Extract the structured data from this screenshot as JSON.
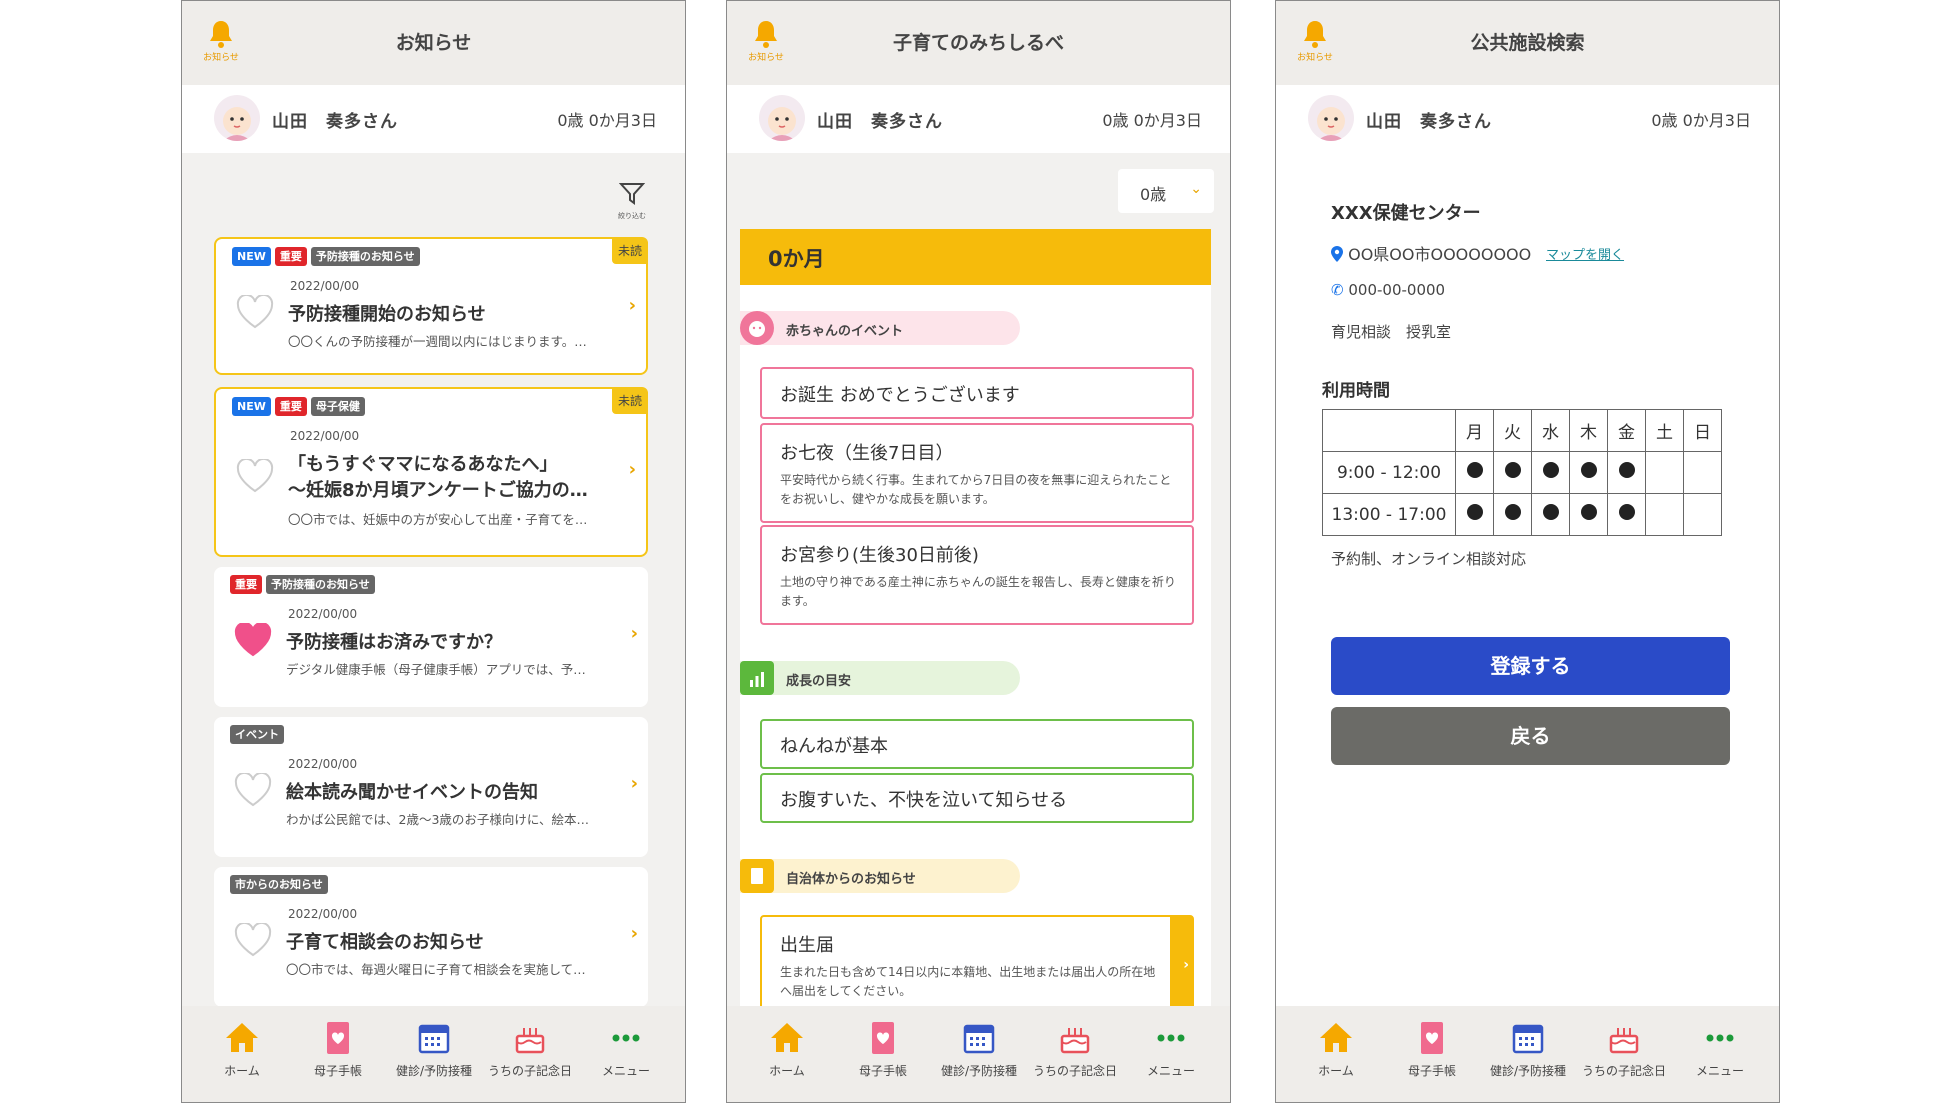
{
  "common": {
    "bell_label": "お知らせ",
    "user_name": "山田　奏多さん",
    "user_age": "0歳 0か月3日",
    "nav": [
      "ホーム",
      "母子手帳",
      "健診/予防接種",
      "うちの子記念日",
      "メニュー"
    ]
  },
  "notices": {
    "title": "お知らせ",
    "filter_label": "絞り込む",
    "unread_label": "未読",
    "items": [
      {
        "tags": [
          "NEW",
          "重要",
          "予防接種のお知らせ"
        ],
        "date": "2022/00/00",
        "title": "予防接種開始のお知らせ",
        "title2": "",
        "excerpt": "〇〇くんの予防接種が一週間以内にはじまります。…",
        "unread": true,
        "liked": false
      },
      {
        "tags": [
          "NEW",
          "重要",
          "母子保健"
        ],
        "date": "2022/00/00",
        "title": "「もうすぐママになるあなたへ」",
        "title2": "～妊娠8か月頃アンケートご協力の…",
        "excerpt": "〇〇市では、妊娠中の方が安心して出産・子育てを…",
        "unread": true,
        "liked": false
      },
      {
        "tags": [
          "重要",
          "予防接種のお知らせ"
        ],
        "date": "2022/00/00",
        "title": "予防接種はお済みですか？",
        "title2": "",
        "excerpt": "デジタル健康手帳（母子健康手帳）アプリでは、予…",
        "unread": false,
        "liked": true
      },
      {
        "tags": [
          "イベント"
        ],
        "date": "2022/00/00",
        "title": "絵本読み聞かせイベントの告知",
        "title2": "",
        "excerpt": "わかば公民館では、2歳～3歳のお子様向けに、絵本…",
        "unread": false,
        "liked": false
      },
      {
        "tags": [
          "市からのお知らせ"
        ],
        "date": "2022/00/00",
        "title": "子育て相談会のお知らせ",
        "title2": "",
        "excerpt": "〇〇市では、毎週火曜日に子育て相談会を実施して…",
        "unread": false,
        "liked": false
      }
    ]
  },
  "guide": {
    "title": "子育てのみちしるべ",
    "age_select": "0歳",
    "month": "0か月",
    "sec_baby": "赤ちゃんのイベント",
    "events": [
      {
        "title": "お誕生 おめでとうございます",
        "desc": ""
      },
      {
        "title": "お七夜（生後7日目）",
        "desc": "平安時代から続く行事。生まれてから7日目の夜を無事に迎えられたことをお祝いし、健やかな成長を願います。"
      },
      {
        "title": "お宮参り(生後30日前後)",
        "desc": "土地の守り神である産土神に赤ちゃんの誕生を報告し、長寿と健康を祈ります。"
      }
    ],
    "sec_growth": "成長の目安",
    "growth": [
      "ねんねが基本",
      "お腹すいた、不快を泣いて知らせる"
    ],
    "sec_city": "自治体からのお知らせ",
    "city": {
      "title": "出生届",
      "desc": "生まれた日も含めて14日以内に本籍地、出生地または届出人の所在地へ届出をしてください。"
    }
  },
  "facility": {
    "title": "公共施設検索",
    "name": "XXX保健センター",
    "address": "OO県OO市OOOOOOOO",
    "map_link": "マップを開く",
    "tel": "000-00-0000",
    "services": "育児相談　授乳室",
    "hours_label": "利用時間",
    "days": [
      "月",
      "火",
      "水",
      "木",
      "金",
      "土",
      "日"
    ],
    "slots": [
      {
        "time": "9:00 - 12:00",
        "open": [
          true,
          true,
          true,
          true,
          true,
          false,
          false
        ]
      },
      {
        "time": "13:00 - 17:00",
        "open": [
          true,
          true,
          true,
          true,
          true,
          false,
          false
        ]
      }
    ],
    "note": "予約制、オンライン相談対応",
    "register_button": "登録する",
    "back_button": "戻る"
  }
}
